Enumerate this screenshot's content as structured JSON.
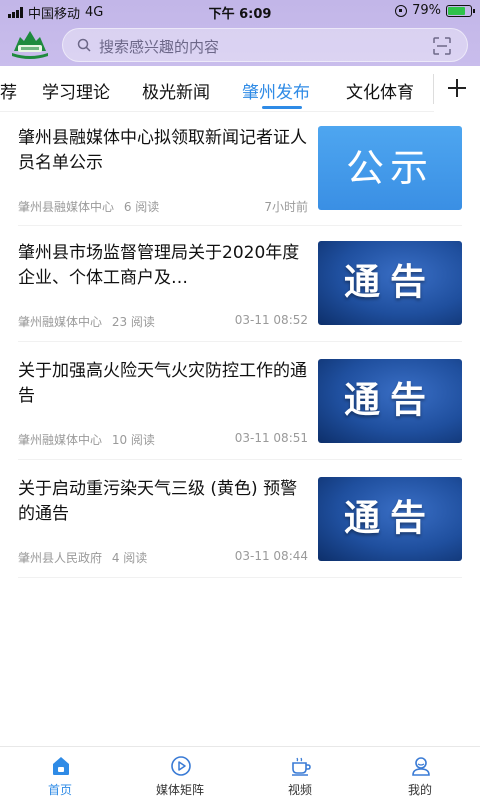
{
  "status_bar": {
    "carrier": "中国移动",
    "network": "4G",
    "time": "下午 6:09",
    "battery": "79%",
    "battery_level": 0.79
  },
  "search": {
    "placeholder": "搜索感兴趣的内容"
  },
  "tabs": [
    {
      "label": "荐",
      "active": false
    },
    {
      "label": "学习理论",
      "active": false
    },
    {
      "label": "极光新闻",
      "active": false
    },
    {
      "label": "肇州发布",
      "active": true
    },
    {
      "label": "文化体育",
      "active": false
    }
  ],
  "news": [
    {
      "title": "肇州县融媒体中心拟领取新闻记者证人员名单公示",
      "source": "肇州县融媒体中心",
      "reads": "6 阅读",
      "time": "7小时前",
      "thumb_text": "公示",
      "thumb_style": "gongshi"
    },
    {
      "title": "肇州县市场监督管理局关于2020年度企业、个体工商户及…",
      "source": "肇州融媒体中心",
      "reads": "23 阅读",
      "time": "03-11 08:52",
      "thumb_text": "通告",
      "thumb_style": "tonggao"
    },
    {
      "title": "关于加强高火险天气火灾防控工作的通告",
      "source": "肇州融媒体中心",
      "reads": "10 阅读",
      "time": "03-11 08:51",
      "thumb_text": "通告",
      "thumb_style": "tonggao"
    },
    {
      "title": "关于启动重污染天气三级 (黄色) 预警的通告",
      "source": "肇州县人民政府",
      "reads": "4 阅读",
      "time": "03-11 08:44",
      "thumb_text": "通告",
      "thumb_style": "tonggao"
    }
  ],
  "bottom_nav": [
    {
      "label": "首页",
      "icon": "home-icon",
      "active": true
    },
    {
      "label": "媒体矩阵",
      "icon": "play-circle-icon",
      "active": false
    },
    {
      "label": "视频",
      "icon": "coffee-cup-icon",
      "active": false
    },
    {
      "label": "我的",
      "icon": "user-icon",
      "active": false
    }
  ],
  "colors": {
    "header_bg": "#c4b8ea",
    "accent": "#2f8be6",
    "meta_text": "#9a9a9a"
  }
}
